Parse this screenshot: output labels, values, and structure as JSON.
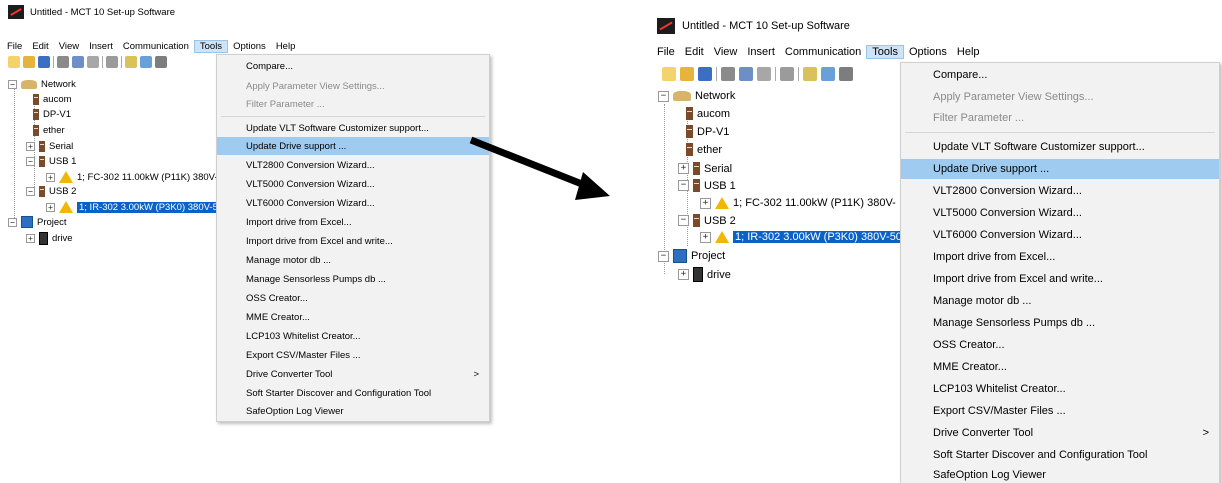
{
  "window": {
    "title": "Untitled - MCT 10 Set-up Software"
  },
  "menubar": {
    "items": [
      "File",
      "Edit",
      "View",
      "Insert",
      "Communication",
      "Tools",
      "Options",
      "Help"
    ],
    "active": "Tools"
  },
  "toolbar": {
    "icons": [
      "new-file-icon",
      "open-folder-icon",
      "save-icon",
      "cut-icon",
      "copy-icon",
      "paste-icon",
      "print-icon",
      "ab-icon",
      "tree-icon",
      "grid-icon"
    ]
  },
  "tree": {
    "network": "Network",
    "aucom": "aucom",
    "dpv1": "DP-V1",
    "ether": "ether",
    "serial": "Serial",
    "usb1": "USB 1",
    "usb1_drive": "1; FC-302 11.00kW (P11K) 380V-",
    "usb2": "USB 2",
    "usb2_drive": "1; IR-302 3.00kW (P3K0) 380V-50",
    "project": "Project",
    "drive": "drive"
  },
  "tools_menu": {
    "compare": "Compare...",
    "apply_param": "Apply Parameter View Settings...",
    "filter_param": "Filter Parameter ...",
    "update_vlt": "Update VLT Software Customizer support...",
    "update_drive": "Update Drive support ...",
    "vlt2800": "VLT2800 Conversion Wizard...",
    "vlt5000": "VLT5000 Conversion Wizard...",
    "vlt6000": "VLT6000 Conversion Wizard...",
    "import_excel": "Import drive from Excel...",
    "import_excel_write": "Import drive from Excel and write...",
    "manage_motor": "Manage motor db ...",
    "manage_pumps": "Manage Sensorless Pumps db ...",
    "oss_creator": "OSS Creator...",
    "mme_creator": "MME Creator...",
    "lcp103": "LCP103 Whitelist Creator...",
    "export_csv": "Export CSV/Master Files ...",
    "drive_converter": "Drive Converter Tool",
    "soft_starter": "Soft Starter Discover and Configuration Tool",
    "safeoption": "SafeOption Log Viewer",
    "submenu_arrow": ">"
  },
  "colors": {
    "highlight": "#9fcbf0",
    "selection": "#0a62c9",
    "menu_bg": "#f2f2f2",
    "arrow": "#000000"
  }
}
